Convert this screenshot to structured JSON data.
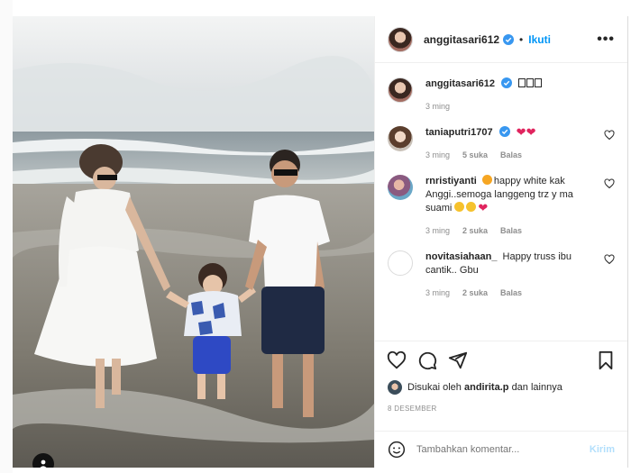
{
  "post": {
    "owner": "anggitasari612",
    "follow_label": "Ikuti",
    "dot": "•",
    "more_label": "•••",
    "caption": {
      "username": "anggitasari612",
      "text": "",
      "time": "3 ming"
    },
    "comments": [
      {
        "username": "taniaputri1707",
        "time": "3 ming",
        "likes": "5 suka",
        "reply_label": "Balas"
      },
      {
        "username": "rnristiyanti",
        "text_a": "happy white kak Anggi..semoga langgeng trz y ma suami",
        "time": "3 ming",
        "likes": "2 suka",
        "reply_label": "Balas"
      },
      {
        "username": "novitasiahaan_",
        "text": "Happy truss ibu cantik.. Gbu",
        "time": "3 ming",
        "likes": "2 suka",
        "reply_label": "Balas"
      }
    ],
    "liked_by": {
      "prefix": "Disukai oleh",
      "user": "andirita.p",
      "suffix": "dan lainnya"
    },
    "date": "8 DESEMBER",
    "add_comment_placeholder": "Tambahkan komentar...",
    "post_label": "Kirim"
  },
  "colors": {
    "accent": "#0095f6",
    "verified": "#3897f0",
    "heart": "#e0245e",
    "muted": "#8e8e8e"
  },
  "icons": [
    "verified-badge-icon",
    "heart-icon",
    "comment-icon",
    "share-icon",
    "bookmark-icon",
    "emoji-icon",
    "user-tag-icon",
    "more-icon"
  ]
}
